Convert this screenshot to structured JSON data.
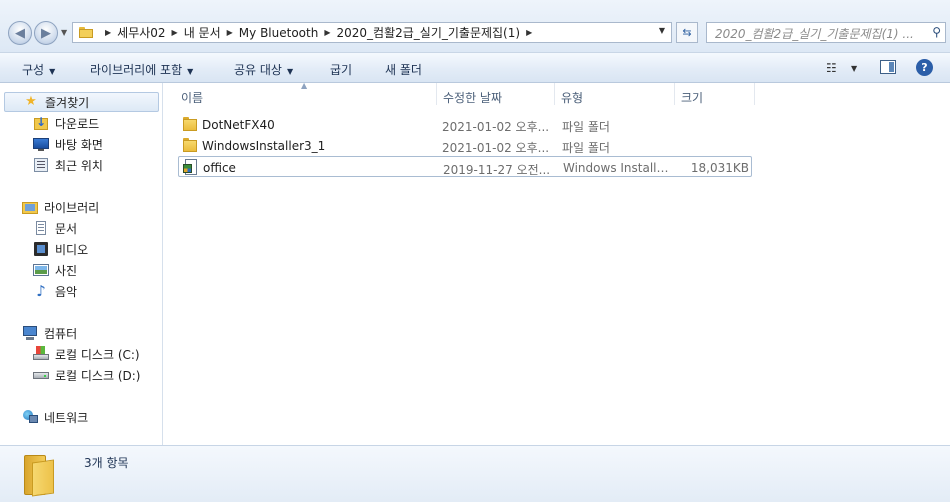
{
  "address_bar": {
    "crumbs": [
      "세무사02",
      "내 문서",
      "My Bluetooth",
      "2020_컴활2급_실기_기출문제집(1)"
    ],
    "search_placeholder": "2020_컴활2급_실기_기출문제집(1) ..."
  },
  "toolbar": {
    "organize": "구성",
    "include_in_library": "라이브러리에 포함",
    "share_with": "공유 대상",
    "burn": "굽기",
    "new_folder": "새 폴더"
  },
  "nav": {
    "favorites": "즐겨찾기",
    "downloads": "다운로드",
    "desktop": "바탕 화면",
    "recent_places": "최근 위치",
    "libraries": "라이브러리",
    "documents": "문서",
    "videos": "비디오",
    "pictures": "사진",
    "music": "음악",
    "computer": "컴퓨터",
    "drive_c": "로컬 디스크 (C:)",
    "drive_d": "로컬 디스크 (D:)",
    "network": "네트워크"
  },
  "columns": {
    "name": "이름",
    "date_modified": "수정한 날짜",
    "type": "유형",
    "size": "크기"
  },
  "files": [
    {
      "name": "DotNetFX40",
      "date": "2021-01-02 오후...",
      "type": "파일 폴더",
      "size": "",
      "icon": "folder-icon"
    },
    {
      "name": "WindowsInstaller3_1",
      "date": "2021-01-02 오후...",
      "type": "파일 폴더",
      "size": "",
      "icon": "folder-icon"
    },
    {
      "name": "office",
      "date": "2019-11-27 오전...",
      "type": "Windows Installer...",
      "size": "18,031KB",
      "icon": "installer-icon"
    }
  ],
  "details": {
    "item_count": "3개 항목"
  }
}
